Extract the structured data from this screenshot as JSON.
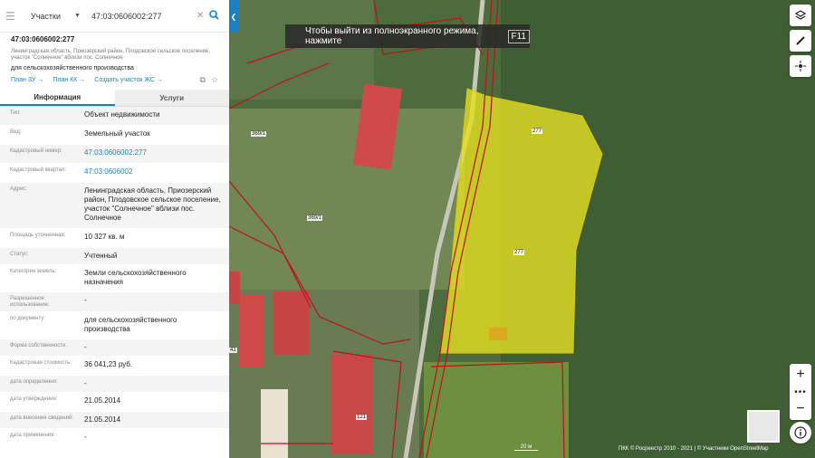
{
  "search": {
    "layer": "Участки",
    "query": "47:03:0606002:277"
  },
  "parcel": {
    "number": "47:03:0606002:277",
    "address": "Ленинградская область, Приозерский район, Плодовское сельское поселение, участок \"Солнечное\" вблизи пос. Солнечное",
    "purpose": "для сельскохозяйственного производства",
    "links": [
      "План ЗУ →",
      "План КК →",
      "Создать участок ЖС →"
    ]
  },
  "tabs": [
    "Информация",
    "Услуги"
  ],
  "info": [
    {
      "k": "Тип:",
      "v": "Объект недвижимости",
      "h": 21
    },
    {
      "k": "Вид:",
      "v": "Земельный участок",
      "h": 21
    },
    {
      "k": "Кадастровый номер:",
      "v": "47:03:0606002:277",
      "h": 21,
      "link": true
    },
    {
      "k": "Кадастровый квартал:",
      "v": "47:03:0606002",
      "h": 21,
      "link": true
    },
    {
      "k": "Адрес:",
      "v": "Ленинградская область, Приозерский район, Плодовское сельское поселение, участок \"Солнечное\" вблизи пос. Солнечное",
      "h": 51
    },
    {
      "k": "Площадь уточненная:",
      "v": "10 327 кв. м",
      "h": 21
    },
    {
      "k": "Статус:",
      "v": "Учтенный",
      "h": 19
    },
    {
      "k": "Категория земель:",
      "v": "Земли сельскохозяйственного назначения",
      "h": 30
    },
    {
      "k": "Разрешенное использование:",
      "v": "-",
      "h": 22
    },
    {
      "k": "по документу:",
      "v": "для сельскохозяйственного производства",
      "h": 30
    },
    {
      "k": "Форма собственности:",
      "v": "-",
      "h": 19
    },
    {
      "k": "Кадастровая стоимость:",
      "v": "36 041,23 руб.",
      "h": 21
    },
    {
      "k": "дата определения:",
      "v": "-",
      "h": 19
    },
    {
      "k": "дата утверждения:",
      "v": "21.05.2014",
      "h": 21
    },
    {
      "k": "дата внесения сведений:",
      "v": "21.05.2014",
      "h": 19
    },
    {
      "k": "дата применения:",
      "v": "-",
      "h": 19
    }
  ],
  "map": {
    "fullscreen_hint": "Чтобы выйти из полноэкранного режима, нажмите",
    "fullscreen_key": "F11",
    "labels": [
      "369/1",
      "369/1",
      "277",
      "277",
      "121",
      "41"
    ],
    "scale": "20 м",
    "attribution": "ПКК © Росреестр 2010 - 2021 | © Участники OpenStreetMap",
    "zoom_in": "+",
    "zoom_out": "−",
    "dots": "•••",
    "colors": {
      "parcel_fill": "#e5e020",
      "boundary": "#c0101a",
      "panel_accent": "#1a7fc1"
    }
  }
}
